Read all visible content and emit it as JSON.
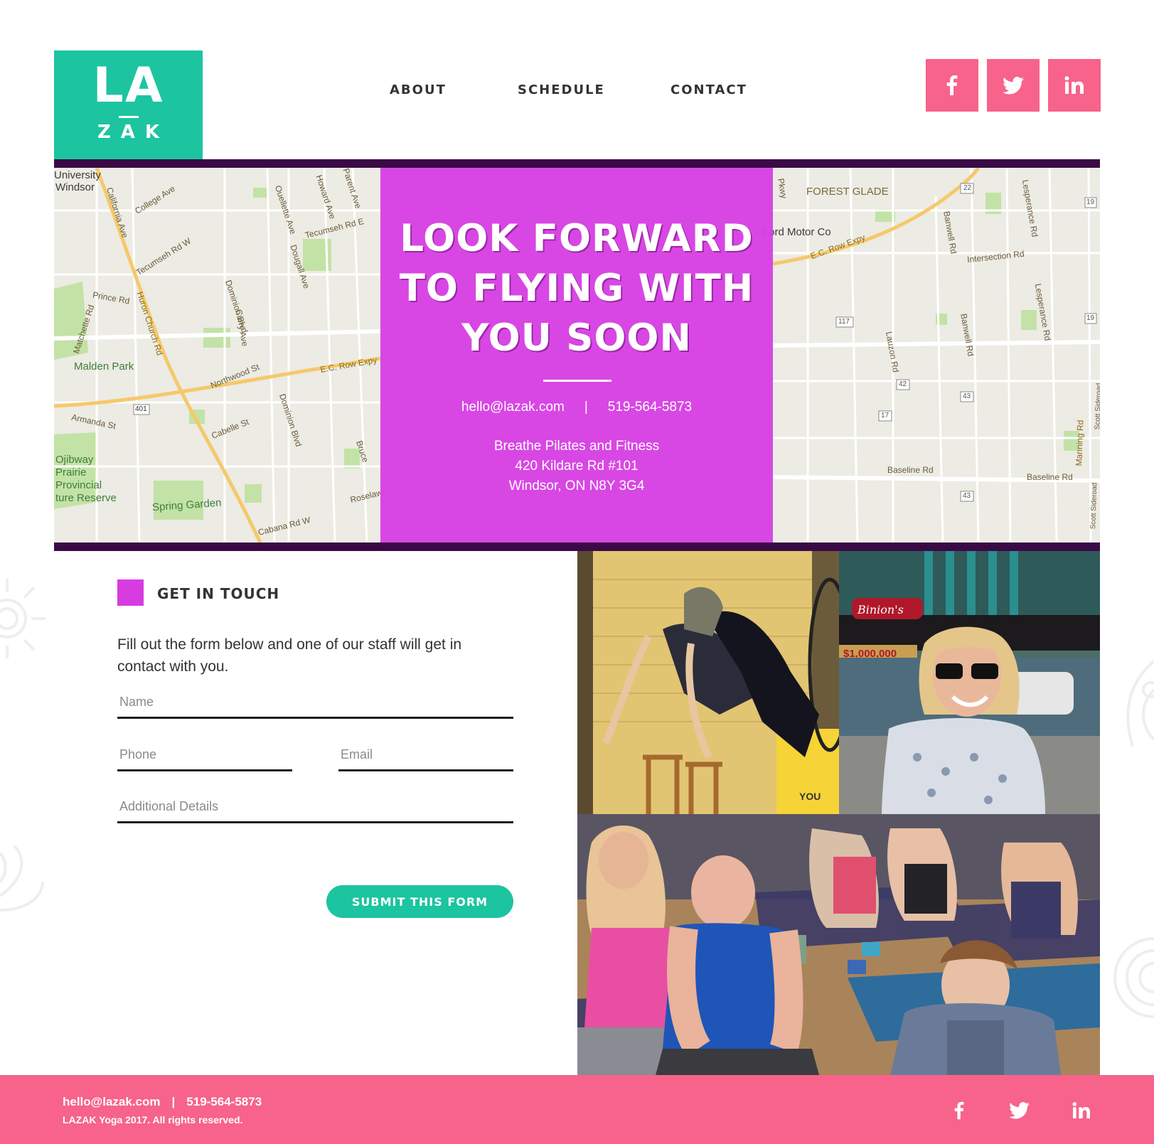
{
  "brand": {
    "logo_top": "LA",
    "logo_bottom": "ZAK",
    "accent_teal": "#1cc4a0",
    "accent_pink": "#f7638a",
    "accent_magenta": "#d63ce0",
    "band_purple": "#3a0a46"
  },
  "nav": {
    "items": [
      {
        "label": "ABOUT"
      },
      {
        "label": "SCHEDULE"
      },
      {
        "label": "CONTACT"
      }
    ]
  },
  "social": {
    "icons": [
      "facebook-icon",
      "twitter-icon",
      "linkedin-icon"
    ]
  },
  "map": {
    "labels": {
      "university": "University",
      "windsor": "Windsor",
      "college_ave": "College Ave",
      "california_ave": "California Ave",
      "tecumseh_w": "Tecumseh Rd W",
      "prince_rd": "Prince Rd",
      "huron_church": "Huron Church Rd",
      "matchette": "Matchette Rd",
      "malden_park": "Malden Park",
      "dominion": "Dominion Blvd",
      "curry": "Curry Ave",
      "northwood": "Northwood St",
      "ouellette": "Ouellette Ave",
      "dougall": "Dougall Ave",
      "howard": "Howard Ave",
      "parent": "Parent Ave",
      "tecumseh_e": "Tecumseh Rd E",
      "ec_row": "E.C. Row Expy",
      "armanda": "Armanda St",
      "cabelle": "Cabelle St",
      "dominion2": "Dominion Blvd",
      "ojibway": "Ojibway\nPrairie\nProvincial\nture Reserve",
      "spring_garden": "Spring Garden",
      "cabana": "Cabana Rd W",
      "roselawn": "Roselawn",
      "bruce": "Bruce",
      "hwy401": "401",
      "forest_glade": "FOREST GLADE",
      "ford": "Ford Motor Co",
      "ec_row_e": "E.C. Row Expy",
      "banwell": "Banwell Rd",
      "banwell2": "Banwell Rd",
      "lesperance": "Lesperance Rd",
      "lesperance2": "Lesperance Rd",
      "intersection": "Intersection Rd",
      "lauzon": "Lauzon Rd",
      "baseline": "Baseline Rd",
      "baseline2": "Baseline Rd",
      "manning": "Manning Rd",
      "scott": "Scott Sideroad",
      "scott2": "Scott Sideroad",
      "s22": "22",
      "s19a": "19",
      "s19b": "19",
      "s117": "117",
      "s42": "42",
      "s43a": "43",
      "s43b": "43",
      "s17": "17",
      "pkwy": "Pkwy"
    }
  },
  "hero": {
    "title_lines": [
      "LOOK FORWARD",
      "TO FLYING WITH",
      "YOU SOON"
    ],
    "email": "hello@lazak.com",
    "separator": "|",
    "phone": "519-564-5873",
    "address_lines": [
      "Breathe Pilates and Fitness",
      "420 Kildare Rd #101",
      "Windsor, ON N8Y 3G4"
    ]
  },
  "contact_form": {
    "heading": "GET IN TOUCH",
    "intro": "Fill out the form below and one of our staff will get in contact with you.",
    "fields": {
      "name": {
        "placeholder": "Name",
        "value": ""
      },
      "phone": {
        "placeholder": "Phone",
        "value": ""
      },
      "email": {
        "placeholder": "Email",
        "value": ""
      },
      "details": {
        "placeholder": "Additional Details",
        "value": ""
      }
    },
    "submit_label": "SUBMIT THIS FORM"
  },
  "photos": {
    "sign_text": "Binion's",
    "marquee": "$1,000,000",
    "poster_text": "YOU"
  },
  "footer": {
    "email": "hello@lazak.com",
    "separator": "|",
    "phone": "519-564-5873",
    "copyright": "LAZAK Yoga 2017. All rights reserved.",
    "icons": [
      "facebook-icon",
      "twitter-icon",
      "linkedin-icon"
    ]
  }
}
